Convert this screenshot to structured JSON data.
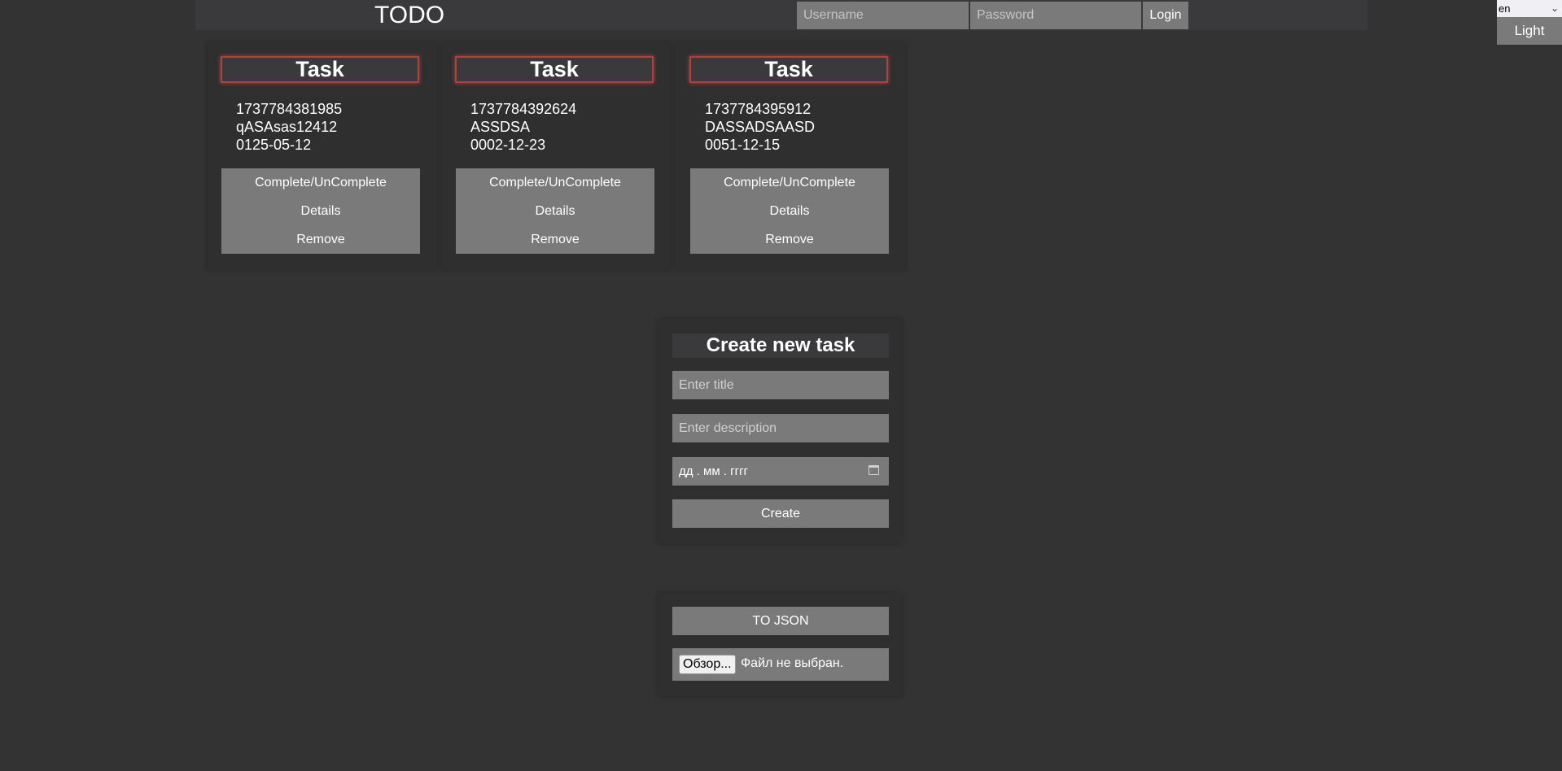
{
  "header": {
    "title": "TODO",
    "username_placeholder": "Username",
    "password_placeholder": "Password",
    "login_label": "Login"
  },
  "settings": {
    "language": "en",
    "theme_label": "Light"
  },
  "tasks": [
    {
      "title": "Task",
      "id": "1737784381985",
      "description": "qASAsas12412",
      "date": "0125-05-12"
    },
    {
      "title": "Task",
      "id": "1737784392624",
      "description": "ASSDSA",
      "date": "0002-12-23"
    },
    {
      "title": "Task",
      "id": "1737784395912",
      "description": "DASSADSAASD",
      "date": "0051-12-15"
    }
  ],
  "task_actions": {
    "complete": "Complete/UnComplete",
    "details": "Details",
    "remove": "Remove"
  },
  "create_form": {
    "heading": "Create new task",
    "title_placeholder": "Enter title",
    "description_placeholder": "Enter description",
    "date_placeholder": "дд . мм . гггг",
    "create_label": "Create"
  },
  "json_panel": {
    "to_json_label": "TO JSON",
    "browse_label": "Обзор...",
    "file_status": "Файл не выбран."
  },
  "colors": {
    "background": "#333333",
    "button": "#7a7a7a",
    "title_border": "#a94442"
  }
}
